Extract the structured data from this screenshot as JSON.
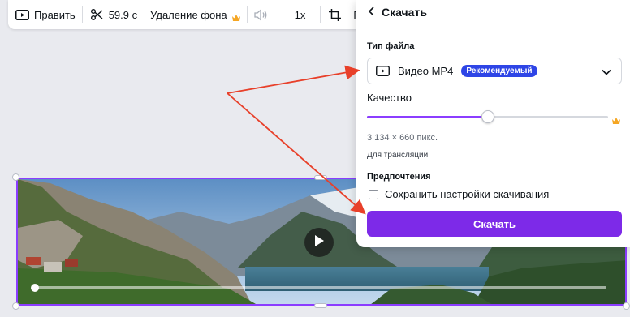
{
  "toolbar": {
    "edit_label": "Править",
    "duration_label": "59.9 с",
    "bg_remove_label": "Удаление фона",
    "speed_label": "1x",
    "trailing_label": "П"
  },
  "panel": {
    "title": "Скачать",
    "file_type_label": "Тип файла",
    "file_type_value": "Видео MP4",
    "recommended_badge": "Рекомендуемый",
    "quality_label": "Качество",
    "quality_fraction": 0.5,
    "dimensions": "3 134 × 660 пикс.",
    "stream_label": "Для трансляции",
    "preferences_label": "Предпочтения",
    "save_settings_label": "Сохранить настройки скачивания",
    "save_settings_checked": false,
    "download_button": "Скачать"
  },
  "colors": {
    "accent": "#8b3dff",
    "button": "#7d2ae8",
    "badge": "#2e45e6",
    "crown": "#f5a623",
    "annotation_arrow": "#e8402a"
  },
  "icons": {
    "edit": "play-box-icon",
    "trim": "scissors-icon",
    "bg_remove_premium": "crown-icon",
    "volume": "speaker-icon",
    "crop": "crop-icon",
    "back": "chevron-left-icon",
    "file_type": "video-icon",
    "dropdown": "chevron-down-icon",
    "quality_premium": "crown-icon",
    "play": "play-icon"
  }
}
